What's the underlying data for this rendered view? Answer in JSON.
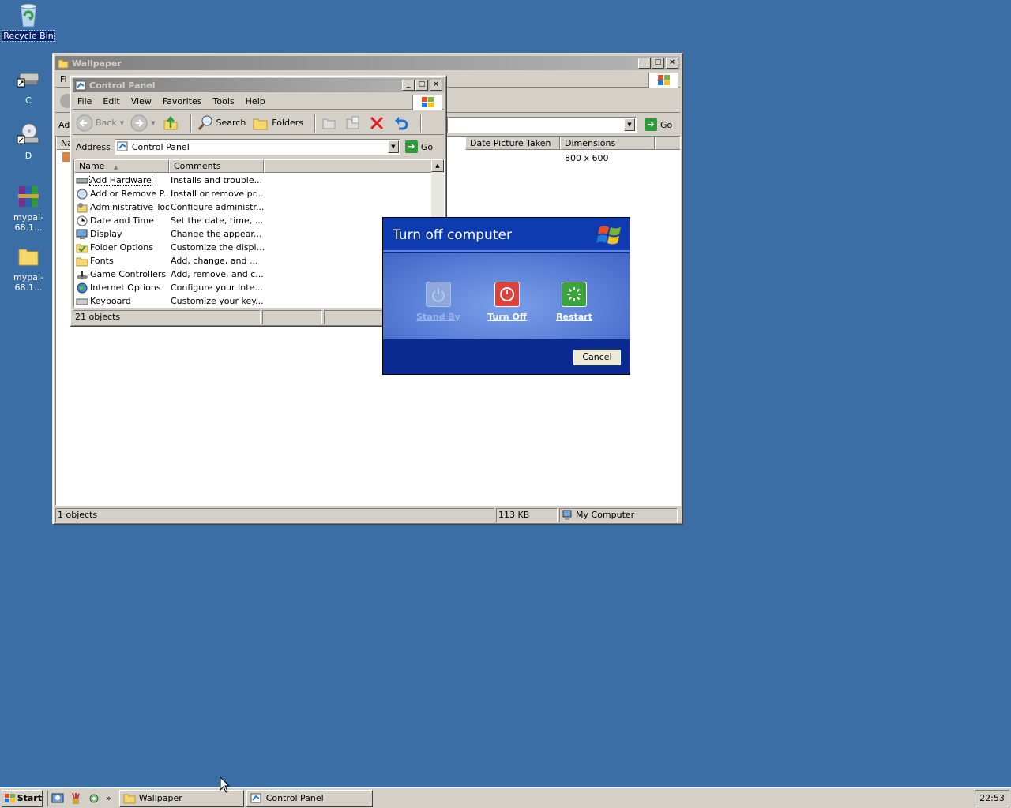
{
  "desktop": {
    "icons": [
      {
        "label": "Recycle Bin",
        "icon": "recycle-bin-icon"
      },
      {
        "label": "C",
        "icon": "drive-shortcut-icon"
      },
      {
        "label": "D",
        "icon": "cd-drive-shortcut-icon"
      },
      {
        "label": "mypal-68.1...",
        "icon": "winrar-archive-icon"
      },
      {
        "label": "mypal-68.1...",
        "icon": "folder-icon"
      }
    ]
  },
  "wallpaper_window": {
    "title": "Wallpaper",
    "menu_partial": "Fi",
    "address_partial": "Ad",
    "go_label": "Go",
    "columns": {
      "name_partial": "Na",
      "date_taken": "Date Picture Taken",
      "dimensions": "Dimensions"
    },
    "row_dimensions": "800 x 600",
    "status": {
      "objects": "1 objects",
      "size": "113 KB",
      "zone": "My Computer"
    }
  },
  "control_panel": {
    "title": "Control Panel",
    "menu": [
      "File",
      "Edit",
      "View",
      "Favorites",
      "Tools",
      "Help"
    ],
    "toolbar": {
      "back": "Back",
      "search": "Search",
      "folders": "Folders"
    },
    "address_label": "Address",
    "address_value": "Control Panel",
    "go_label": "Go",
    "columns": {
      "name": "Name",
      "comments": "Comments"
    },
    "items": [
      {
        "name": "Add Hardware",
        "comment": "Installs and trouble...",
        "icon": "hardware-icon"
      },
      {
        "name": "Add or Remove P...",
        "comment": "Install or remove pr...",
        "icon": "add-remove-programs-icon"
      },
      {
        "name": "Administrative Tools",
        "comment": "Configure administr...",
        "icon": "admin-tools-icon"
      },
      {
        "name": "Date and Time",
        "comment": "Set the date, time, ...",
        "icon": "clock-icon"
      },
      {
        "name": "Display",
        "comment": "Change the appear...",
        "icon": "display-icon"
      },
      {
        "name": "Folder Options",
        "comment": "Customize the displ...",
        "icon": "folder-options-icon"
      },
      {
        "name": "Fonts",
        "comment": "Add, change, and ...",
        "icon": "fonts-folder-icon"
      },
      {
        "name": "Game Controllers",
        "comment": "Add, remove, and c...",
        "icon": "joystick-icon"
      },
      {
        "name": "Internet Options",
        "comment": "Configure your Inte...",
        "icon": "globe-icon"
      },
      {
        "name": "Keyboard",
        "comment": "Customize your key...",
        "icon": "keyboard-icon"
      }
    ],
    "status": {
      "objects": "21 objects"
    }
  },
  "turnoff_dialog": {
    "title": "Turn off computer",
    "standby": "Stand By",
    "turnoff": "Turn Off",
    "restart": "Restart",
    "cancel": "Cancel"
  },
  "taskbar": {
    "start": "Start",
    "chevron": "»",
    "tasks": [
      "Wallpaper",
      "Control Panel"
    ],
    "clock": "22:53"
  },
  "colors": {
    "desktop": "#3a6ea5",
    "dialog_blue": "#0a2a92",
    "turnoff_red": "#e0403a",
    "restart_green": "#3aa53a"
  }
}
